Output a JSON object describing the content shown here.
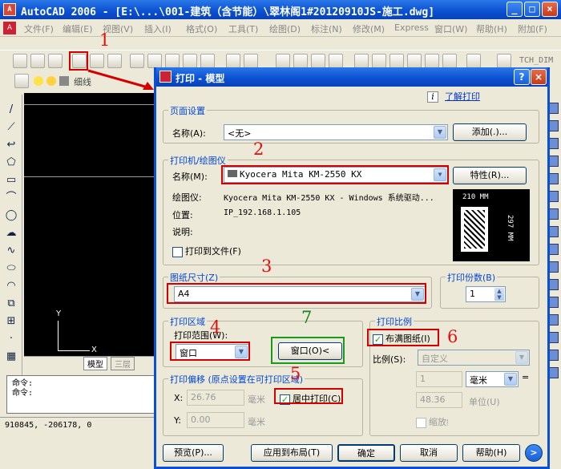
{
  "app": {
    "title": "AutoCAD 2006 - [E:\\...\\001-建筑（含节能）\\翠林阁1#20120910JS-施工.dwg]",
    "menu": [
      "文件(F)",
      "编辑(E)",
      "视图(V)",
      "插入(I)",
      "格式(O)",
      "工具(T)",
      "绘图(D)",
      "标注(N)",
      "修改(M)",
      "Express",
      "窗口(W)",
      "帮助(H)",
      "附加(F)"
    ],
    "toolbar_extra": "TCH_DIM",
    "layer_label": "细线",
    "tabs": [
      "模型",
      "三层"
    ],
    "command_lines": [
      "命令:",
      "命令:"
    ],
    "coords": "910845, -206178, 0",
    "axis_x": "X",
    "axis_y": "Y"
  },
  "dialog": {
    "title": "打印 - 模型",
    "learn_link": "了解打印",
    "info_icon": "i",
    "page_setup": {
      "legend": "页面设置",
      "name_label": "名称(A):",
      "name_value": "<无>",
      "add_button": "添加(.)..."
    },
    "printer": {
      "legend": "打印机/绘图仪",
      "name_label": "名称(M):",
      "name_value": "Kyocera Mita KM-2550 KX",
      "properties_button": "特性(R)...",
      "plotter_label": "绘图仪:",
      "plotter_value": "Kyocera Mita KM-2550 KX - Windows 系统驱动...",
      "where_label": "位置:",
      "where_value": "IP_192.168.1.105",
      "desc_label": "说明:",
      "plot_to_file": "打印到文件(F)",
      "preview_width": "210 MM",
      "preview_height": "297 MM"
    },
    "paper_size": {
      "legend": "图纸尺寸(Z)",
      "value": "A4"
    },
    "copies": {
      "legend": "打印份数(B)",
      "value": "1"
    },
    "plot_area": {
      "legend": "打印区域",
      "what_label": "打印范围(W):",
      "what_value": "窗口",
      "window_button": "窗口(O)<"
    },
    "plot_scale": {
      "legend": "打印比例",
      "fit_paper": "布满图纸(I)",
      "scale_label": "比例(S):",
      "scale_value": "自定义",
      "value1": "1",
      "unit": "毫米",
      "eq": "=",
      "value2": "48.36",
      "unit_label": "单位(U)",
      "lineweights": "缩放线宽(L)"
    },
    "plot_offset": {
      "legend": "打印偏移 (原点设置在可打印区域)",
      "x_label": "X:",
      "x_value": "26.76",
      "y_label": "Y:",
      "y_value": "0.00",
      "unit": "毫米",
      "center": "居中打印(C)"
    },
    "footer": {
      "preview": "预览(P)...",
      "apply": "应用到布局(T)",
      "ok": "确定",
      "cancel": "取消",
      "help": "帮助(H)",
      "more": ">"
    }
  },
  "annotations": [
    "1",
    "2",
    "3",
    "4",
    "5",
    "6",
    "7"
  ],
  "colors": {
    "annotation_red": "#d40000",
    "annotation_green": "#1a9a1a",
    "xp_blue": "#0a4fd0"
  }
}
